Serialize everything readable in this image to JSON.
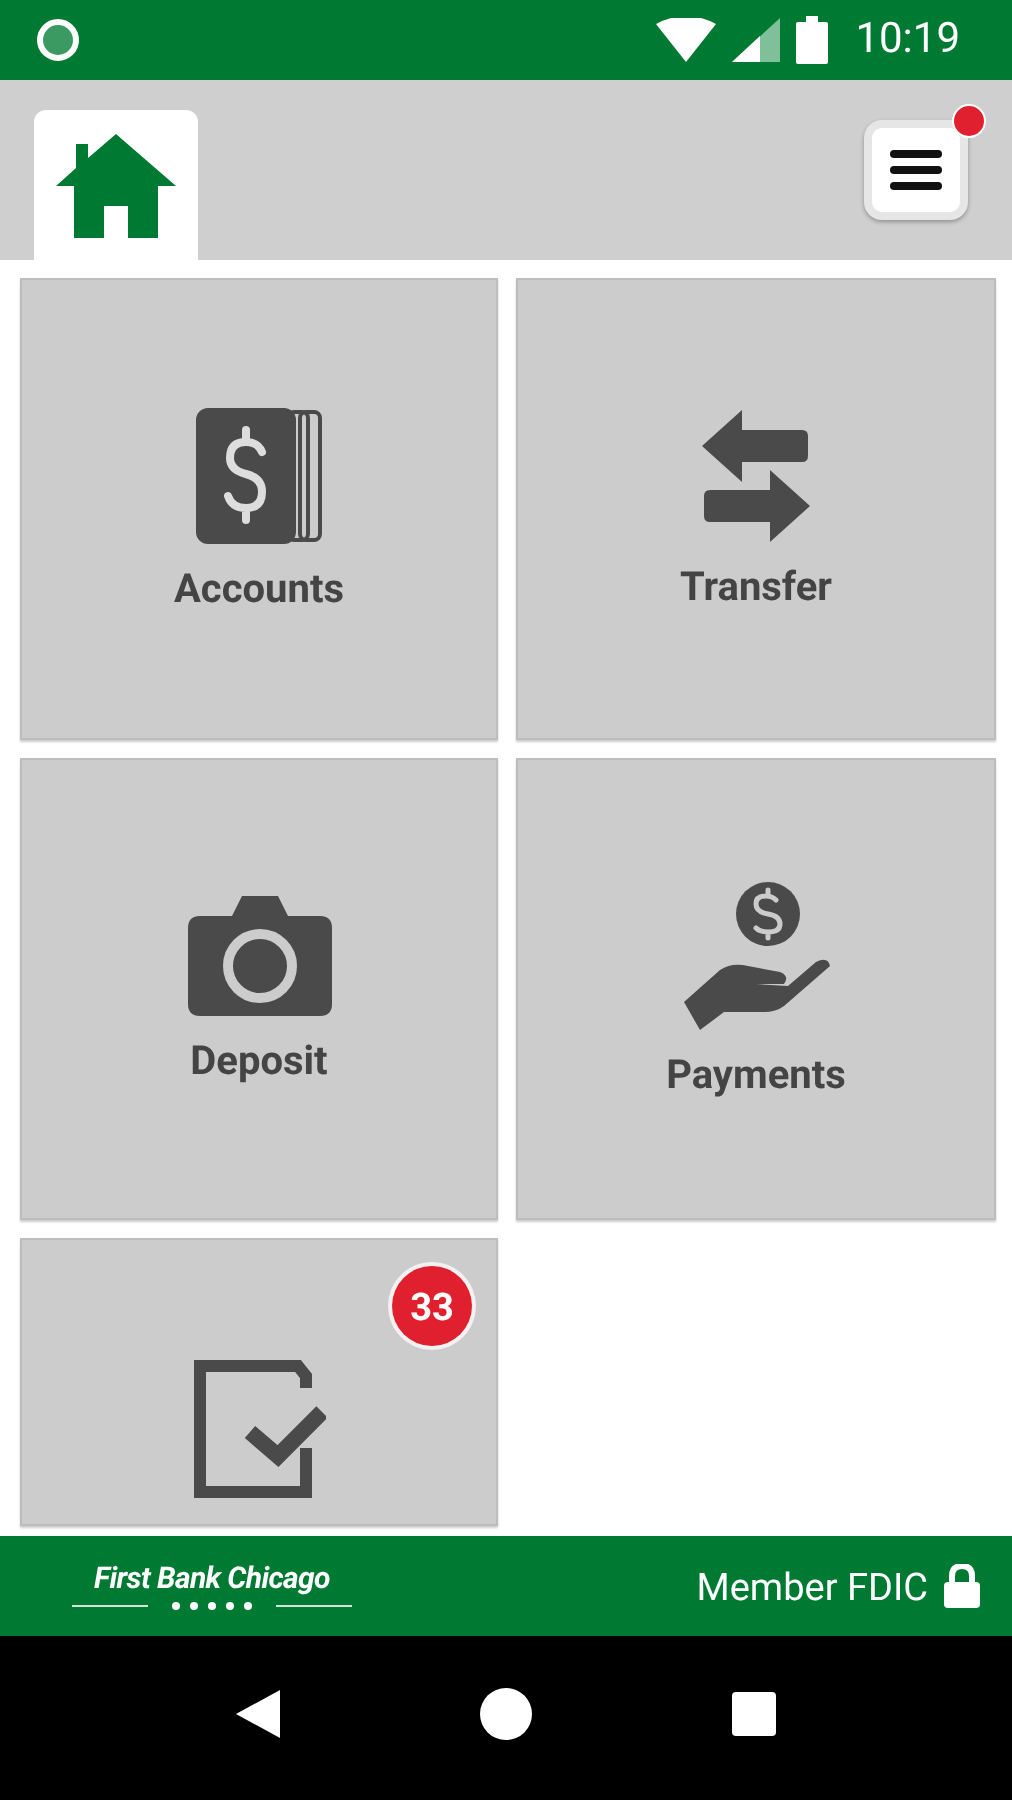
{
  "status_bar": {
    "time": "10:19"
  },
  "header": {
    "home_tab": {
      "selected": true
    },
    "menu": {
      "notification": true
    }
  },
  "tiles": [
    {
      "kind": "accounts",
      "label": "Accounts"
    },
    {
      "kind": "transfer",
      "label": "Transfer"
    },
    {
      "kind": "deposit",
      "label": "Deposit"
    },
    {
      "kind": "payments",
      "label": "Payments"
    },
    {
      "kind": "tasks",
      "badge": "33"
    }
  ],
  "footer": {
    "brand": "First Bank Chicago",
    "member": "Member FDIC"
  }
}
